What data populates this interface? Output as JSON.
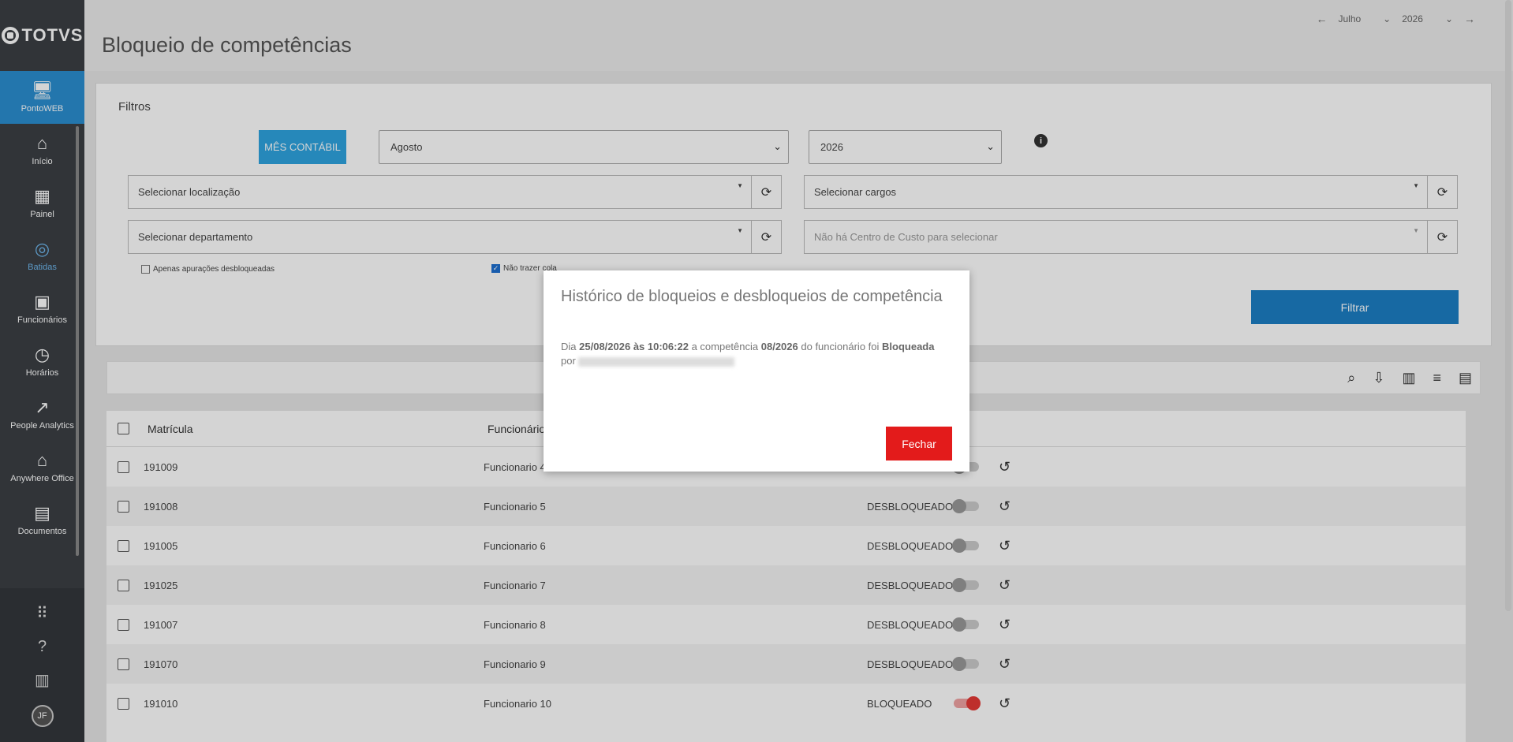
{
  "brand": {
    "logo_text": "TOTVS"
  },
  "sidebar": {
    "items": [
      {
        "label": "PontoWEB",
        "icon": "monitor-icon"
      },
      {
        "label": "Início",
        "icon": "home-icon"
      },
      {
        "label": "Painel",
        "icon": "dashboard-icon"
      },
      {
        "label": "Batidas",
        "icon": "fingerprint-icon"
      },
      {
        "label": "Funcionários",
        "icon": "badge-icon"
      },
      {
        "label": "Horários",
        "icon": "clock-icon"
      },
      {
        "label": "People Analytics",
        "icon": "trend-icon"
      },
      {
        "label": "Anywhere Office",
        "icon": "house-work-icon"
      },
      {
        "label": "Documentos",
        "icon": "document-icon"
      }
    ],
    "avatar_initials": "JF"
  },
  "header": {
    "title": "Bloqueio de competências",
    "month": "Julho",
    "year": "2026"
  },
  "filters": {
    "title": "Filtros",
    "mes_contabil_label": "MÊS CONTÁBIL",
    "month_select": "Agosto",
    "year_select": "2026",
    "localizacao_placeholder": "Selecionar localização",
    "cargos_placeholder": "Selecionar cargos",
    "departamento_placeholder": "Selecionar departamento",
    "centro_custo_placeholder": "Não há Centro de Custo para selecionar",
    "chk_desbloqueadas": "Apenas apurações desbloqueadas",
    "chk_nao_trazer": "Não trazer cola",
    "filtrar_label": "Filtrar"
  },
  "table": {
    "headers": {
      "matricula": "Matrícula",
      "funcionario": "Funcionário"
    },
    "rows": [
      {
        "matricula": "191009",
        "funcionario": "Funcionario 4",
        "status": "",
        "locked": false
      },
      {
        "matricula": "191008",
        "funcionario": "Funcionario 5",
        "status": "DESBLOQUEADO",
        "locked": false
      },
      {
        "matricula": "191005",
        "funcionario": "Funcionario 6",
        "status": "DESBLOQUEADO",
        "locked": false
      },
      {
        "matricula": "191025",
        "funcionario": "Funcionario 7",
        "status": "DESBLOQUEADO",
        "locked": false
      },
      {
        "matricula": "191007",
        "funcionario": "Funcionario 8",
        "status": "DESBLOQUEADO",
        "locked": false
      },
      {
        "matricula": "191070",
        "funcionario": "Funcionario 9",
        "status": "DESBLOQUEADO",
        "locked": false
      },
      {
        "matricula": "191010",
        "funcionario": "Funcionario 10",
        "status": "BLOQUEADO",
        "locked": true
      }
    ]
  },
  "modal": {
    "title": "Histórico de bloqueios e desbloqueios de competência",
    "text_dia": "Dia",
    "date": "25/08/2026 às 10:06:22",
    "text_a_competencia": "a competência",
    "competencia": "08/2026",
    "text_do_funcionario": "do funcionário foi",
    "acao": "Bloqueada",
    "text_por": "por",
    "close_label": "Fechar"
  },
  "colors": {
    "accent": "#2b8ed0",
    "danger": "#e31b1b",
    "sidebar": "#3b3f44"
  }
}
